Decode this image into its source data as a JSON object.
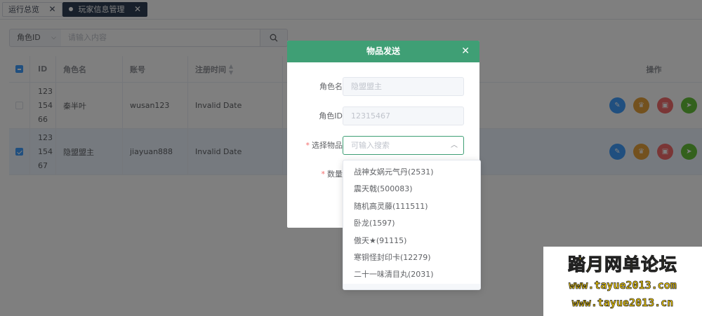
{
  "tabs": [
    {
      "label": "运行总览",
      "close": "✕"
    },
    {
      "label": "玩家信息管理",
      "close": "✕"
    }
  ],
  "search": {
    "select_value": "角色ID",
    "placeholder": "请输入内容"
  },
  "table": {
    "headers": {
      "id": "ID",
      "name": "角色名",
      "account": "账号",
      "register_time": "注册时间",
      "actions": "操作"
    },
    "rows": [
      {
        "id_lines": [
          "123",
          "154",
          "66"
        ],
        "name": "秦半叶",
        "account": "wusan123",
        "register_time": "Invalid Date",
        "checked": false
      },
      {
        "id_lines": [
          "123",
          "154",
          "67"
        ],
        "name": "隐盟盟主",
        "account": "jiayuan888",
        "register_time": "Invalid Date",
        "checked": true
      }
    ]
  },
  "dialog": {
    "title": "物品发送",
    "close": "✕",
    "fields": {
      "role_name": {
        "label": "角色名",
        "value": "隐盟盟主"
      },
      "role_id": {
        "label": "角色ID",
        "value": "12315467"
      },
      "item": {
        "label": "选择物品",
        "placeholder": "可输入搜索",
        "required": "*"
      },
      "quantity": {
        "label": "数量",
        "required": "*"
      }
    }
  },
  "dropdown": {
    "options": [
      "战神女娲元气丹(2531)",
      "震天戟(500083)",
      "随机高灵藤(111511)",
      "卧龙(1597)",
      "傲天★(91115)",
      "寒铜怪封印卡(12279)",
      "二十一味清目丸(2031)"
    ]
  },
  "watermark": {
    "title": "踏月网单论坛",
    "url1": "www.tayue2013.com",
    "url2": "www.tayue2013.cn"
  },
  "colors": {
    "dialog_header": "#3f9f75",
    "primary": "#409eff",
    "warning": "#e6a23c",
    "danger": "#f56c6c",
    "success": "#67c23a"
  },
  "icons": {
    "edit": "edit-icon",
    "trophy": "trophy-icon",
    "lock": "lock-icon",
    "send": "send-icon"
  }
}
